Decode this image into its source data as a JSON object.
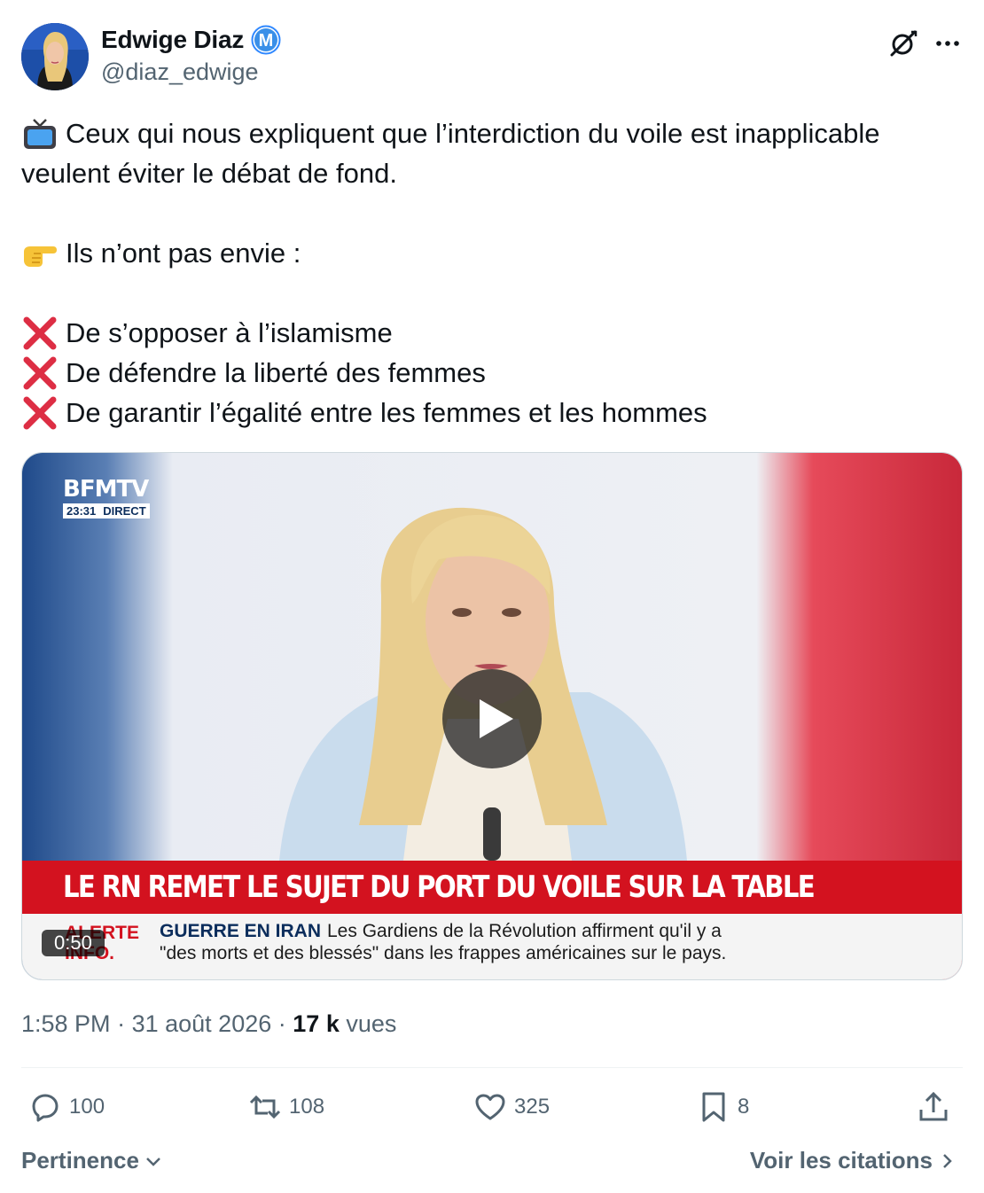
{
  "author": {
    "display_name": "Edwige Diaz",
    "handle": "@diaz_edwige",
    "avatar_icon": "profile-photo",
    "badge_icon": "m-badge-icon",
    "badge_color": "#2f88ff"
  },
  "tweet": {
    "lines": [
      {
        "emoji": "television",
        "text": "Ceux qui nous expliquent que l’interdiction du voile est inapplicable"
      },
      {
        "emoji": "",
        "text": "veulent éviter le débat de fond."
      },
      {
        "emoji": "backhand-index-right",
        "text": "Ils n’ont pas envie :"
      },
      {
        "emoji": "cross-mark",
        "text": "De s’opposer à l’islamisme"
      },
      {
        "emoji": "cross-mark",
        "text": "De défendre la liberté des femmes"
      },
      {
        "emoji": "cross-mark",
        "text": "De garantir l’égalité entre les femmes et les hommes"
      }
    ]
  },
  "video": {
    "channel_logo": "BFMTV",
    "time": "23:31",
    "live_label": "DIRECT",
    "headline": "LE RN REMET LE SUJET DU PORT DU VOILE SUR LA TABLE",
    "alert_label": "ALERTE INFO.",
    "ticker_head": "GUERRE EN IRAN",
    "ticker_line1": "Les Gardiens de la Révolution affirment qu'il y a",
    "ticker_line2": "\"des morts et des blessés\" dans les frappes américaines sur le pays.",
    "duration": "0:50",
    "play_icon": "play-icon"
  },
  "meta": {
    "time": "1:58 PM",
    "date": "31 août 2026",
    "views_count": "17 k",
    "views_label": "vues",
    "separator": "·"
  },
  "actions": {
    "replies": "100",
    "reposts": "108",
    "likes": "325",
    "bookmarks": "8"
  },
  "footer": {
    "sort_label": "Pertinence",
    "quotes_label": "Voir les citations"
  }
}
